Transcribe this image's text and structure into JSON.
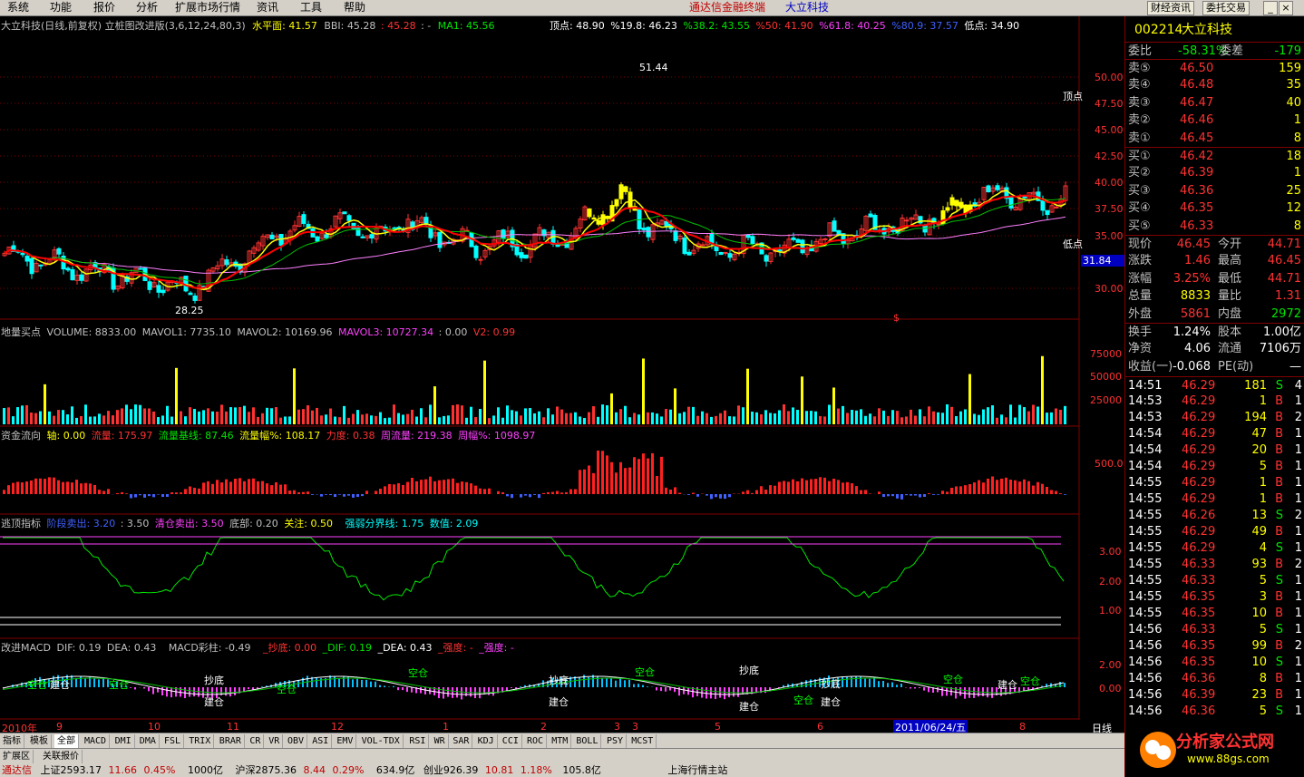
{
  "menu": [
    "系统",
    "功能",
    "报价",
    "分析",
    "扩展市场行情",
    "资讯",
    "工具",
    "帮助"
  ],
  "app_title": "通达信金融终端",
  "stock_title": "大立科技",
  "top_buttons": [
    "财经资讯",
    "委托交易"
  ],
  "main_header": {
    "name": "大立科技(日线,前复权) 立桩图改进版(3,6,12,24,80,3)",
    "shuiping": "水平面: 41.57",
    "bbi": "BBI: 45.28",
    "bbi2": ": 45.28",
    "dash": ": -",
    "ma1": "MA1: 45.56",
    "topval": "顶点: 48.90",
    "p198": "%19.8: 46.23",
    "p382": "%38.2: 43.55",
    "p50": "%50: 41.90",
    "p618": "%61.8: 40.25",
    "p809": "%80.9: 37.57",
    "lowval": "低点: 34.90"
  },
  "price_axis": [
    "50.00",
    "47.50",
    "45.00",
    "42.50",
    "40.00",
    "37.50",
    "35.00",
    "30.00"
  ],
  "price_marks": {
    "high": "51.44",
    "low": "28.25",
    "top_label": "顶点",
    "bottom_label": "低点",
    "current": "31.84",
    "s_mark": "$"
  },
  "vol_header": {
    "title": "地量买点",
    "volume": "VOLUME: 8833.00",
    "mavol1": "MAVOL1: 7735.10",
    "mavol2": "MAVOL2: 10169.96",
    "mavol3": "MAVOL3: 10727.34",
    "zero": ": 0.00",
    "v2": "V2: 0.99"
  },
  "vol_axis": [
    "75000",
    "50000",
    "25000"
  ],
  "flow_header": {
    "title": "资金流向",
    "axis": "轴: 0.00",
    "flow": "流量: 175.97",
    "base": "流量基线: 87.46",
    "amp": "流量幅%: 108.17",
    "force": "力度: 0.38",
    "week": "周流量: 219.38",
    "week_amp": "周幅%: 1098.97"
  },
  "flow_axis": [
    "500.0"
  ],
  "escape_header": {
    "title": "逃顶指标",
    "stage": "阶段卖出: 3.20",
    "v350": ": 3.50",
    "clear": "清仓卖出: 3.50",
    "bottom": "底部: 0.20",
    "focus": "关注: 0.50",
    "line": "强弱分界线: 1.75",
    "num": "数值: 2.09"
  },
  "escape_axis": [
    "3.00",
    "2.00",
    "1.00"
  ],
  "macd_header": {
    "title": "改进MACD",
    "dif": "DIF: 0.19",
    "dea": "DEA: 0.43",
    "bar": "MACD彩柱: -0.49",
    "chaodi": "_抄底: 0.00",
    "dif2": "_DIF: 0.19",
    "dea2": "_DEA: 0.43",
    "strong": "_强度: -",
    "strong2": "_强度: -"
  },
  "macd_axis": [
    "2.00",
    "0.00"
  ],
  "macd_labels": {
    "chaodi": "抄底",
    "jiancang": "建仓",
    "kongcang": "空仓"
  },
  "time_axis": [
    "2010年",
    "9",
    "10",
    "11",
    "12",
    "1",
    "2",
    "3",
    "4",
    "5",
    "6",
    "2011/06/24/五",
    "8"
  ],
  "period": "日线",
  "tabs": [
    "指标",
    "模板",
    "全部",
    "MACD",
    "DMI",
    "DMA",
    "FSL",
    "TRIX",
    "BRAR",
    "CR",
    "VR",
    "OBV",
    "ASI",
    "EMV",
    "VOL-TDX",
    "RSI",
    "WR",
    "SAR",
    "KDJ",
    "CCI",
    "ROC",
    "MTM",
    "BOLL",
    "PSY",
    "MCST"
  ],
  "subtabs": [
    "扩展区",
    "关联报价"
  ],
  "quote": {
    "code": "002214",
    "name": "大立科技",
    "weibi_label": "委比",
    "weibi": "-58.31%",
    "weicha_label": "委差",
    "weicha": "-179",
    "sells": [
      {
        "label": "卖⑤",
        "price": "46.50",
        "vol": "159"
      },
      {
        "label": "卖④",
        "price": "46.48",
        "vol": "35"
      },
      {
        "label": "卖③",
        "price": "46.47",
        "vol": "40"
      },
      {
        "label": "卖②",
        "price": "46.46",
        "vol": "1"
      },
      {
        "label": "卖①",
        "price": "46.45",
        "vol": "8"
      }
    ],
    "buys": [
      {
        "label": "买①",
        "price": "46.42",
        "vol": "18"
      },
      {
        "label": "买②",
        "price": "46.39",
        "vol": "1"
      },
      {
        "label": "买③",
        "price": "46.36",
        "vol": "25"
      },
      {
        "label": "买④",
        "price": "46.35",
        "vol": "12"
      },
      {
        "label": "买⑤",
        "price": "46.33",
        "vol": "8"
      }
    ],
    "stats": [
      {
        "l1": "现价",
        "v1": "46.45",
        "l2": "今开",
        "v2": "44.71",
        "c1": "red",
        "c2": "red"
      },
      {
        "l1": "涨跌",
        "v1": "1.46",
        "l2": "最高",
        "v2": "46.45",
        "c1": "red",
        "c2": "red"
      },
      {
        "l1": "涨幅",
        "v1": "3.25%",
        "l2": "最低",
        "v2": "44.71",
        "c1": "red",
        "c2": "red"
      },
      {
        "l1": "总量",
        "v1": "8833",
        "l2": "量比",
        "v2": "1.31",
        "c1": "yel",
        "c2": "red"
      },
      {
        "l1": "外盘",
        "v1": "5861",
        "l2": "内盘",
        "v2": "2972",
        "c1": "red",
        "c2": "grn"
      }
    ],
    "stats2": [
      {
        "l1": "换手",
        "v1": "1.24%",
        "l2": "股本",
        "v2": "1.00亿"
      },
      {
        "l1": "净资",
        "v1": "4.06",
        "l2": "流通",
        "v2": "7106万"
      },
      {
        "l1": "收益(一)",
        "v1": "-0.068",
        "l2": "PE(动)",
        "v2": "—"
      }
    ],
    "ticks": [
      {
        "t": "14:51",
        "p": "46.29",
        "v": "181",
        "s": "S",
        "n": "4"
      },
      {
        "t": "14:53",
        "p": "46.29",
        "v": "1",
        "s": "B",
        "n": "1"
      },
      {
        "t": "14:53",
        "p": "46.29",
        "v": "194",
        "s": "B",
        "n": "2"
      },
      {
        "t": "14:54",
        "p": "46.29",
        "v": "47",
        "s": "B",
        "n": "1"
      },
      {
        "t": "14:54",
        "p": "46.29",
        "v": "20",
        "s": "B",
        "n": "1"
      },
      {
        "t": "14:54",
        "p": "46.29",
        "v": "5",
        "s": "B",
        "n": "1"
      },
      {
        "t": "14:55",
        "p": "46.29",
        "v": "1",
        "s": "B",
        "n": "1"
      },
      {
        "t": "14:55",
        "p": "46.29",
        "v": "1",
        "s": "B",
        "n": "1"
      },
      {
        "t": "14:55",
        "p": "46.26",
        "v": "13",
        "s": "S",
        "n": "2"
      },
      {
        "t": "14:55",
        "p": "46.29",
        "v": "49",
        "s": "B",
        "n": "1"
      },
      {
        "t": "14:55",
        "p": "46.29",
        "v": "4",
        "s": "S",
        "n": "1"
      },
      {
        "t": "14:55",
        "p": "46.33",
        "v": "93",
        "s": "B",
        "n": "2"
      },
      {
        "t": "14:55",
        "p": "46.33",
        "v": "5",
        "s": "S",
        "n": "1"
      },
      {
        "t": "14:55",
        "p": "46.35",
        "v": "3",
        "s": "B",
        "n": "1"
      },
      {
        "t": "14:55",
        "p": "46.35",
        "v": "10",
        "s": "B",
        "n": "1"
      },
      {
        "t": "14:56",
        "p": "46.33",
        "v": "5",
        "s": "S",
        "n": "1"
      },
      {
        "t": "14:56",
        "p": "46.35",
        "v": "99",
        "s": "B",
        "n": "2"
      },
      {
        "t": "14:56",
        "p": "46.35",
        "v": "10",
        "s": "S",
        "n": "1"
      },
      {
        "t": "14:56",
        "p": "46.36",
        "v": "8",
        "s": "B",
        "n": "1"
      },
      {
        "t": "14:56",
        "p": "46.39",
        "v": "23",
        "s": "B",
        "n": "1"
      },
      {
        "t": "14:56",
        "p": "46.36",
        "v": "5",
        "s": "S",
        "n": "1"
      }
    ]
  },
  "status_bar": {
    "label": "通达信",
    "sh": "上证2593.17",
    "sh_chg": "11.66",
    "sh_pct": "0.45%",
    "sh_amt": "1000亿",
    "sz": "沪深2875.36",
    "sz_chg": "8.44",
    "sz_pct": "0.29%",
    "sz_amt": "634.9亿",
    "cy": "创业926.39",
    "cy_chg": "10.81",
    "cy_pct": "1.18%",
    "cy_amt": "105.8亿",
    "site": "上海行情主站"
  },
  "logo": {
    "text": "分析家公式网",
    "url": "www.88gs.com"
  }
}
